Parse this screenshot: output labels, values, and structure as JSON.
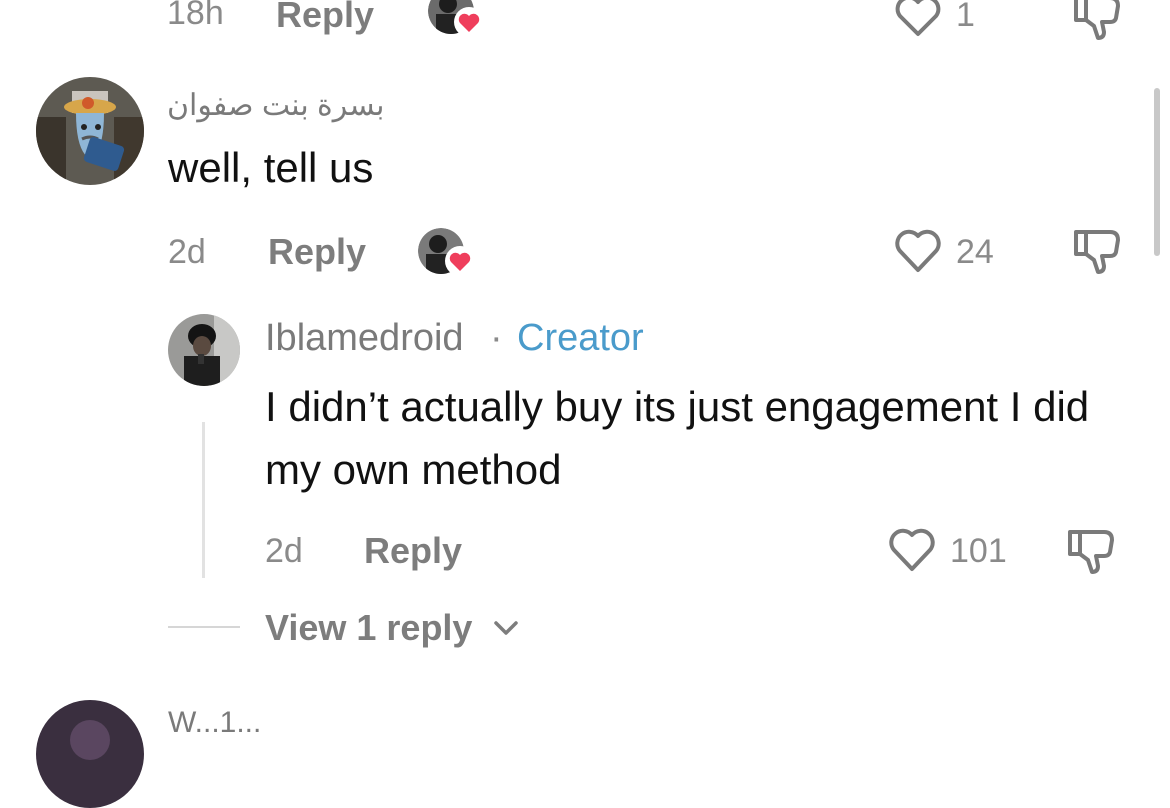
{
  "top_row": {
    "time": "18h",
    "reply_label": "Reply",
    "likes": "1"
  },
  "comment1": {
    "username": "بسرة بنت صفوان",
    "text": "well, tell us",
    "time": "2d",
    "reply_label": "Reply",
    "likes": "24"
  },
  "reply1": {
    "username": "Iblamedroid",
    "separator": "·",
    "creator_badge": "Creator",
    "text": "I didn’t actually buy its just engagement I did my own method",
    "time": "2d",
    "reply_label": "Reply",
    "likes": "101"
  },
  "view_replies": {
    "label": "View 1 reply"
  },
  "next_comment": {
    "username": "W...1..."
  },
  "colors": {
    "creator": "#4a9bcb",
    "heart_badge": "#ef3e5c",
    "meta_text": "#8a8a8a"
  }
}
